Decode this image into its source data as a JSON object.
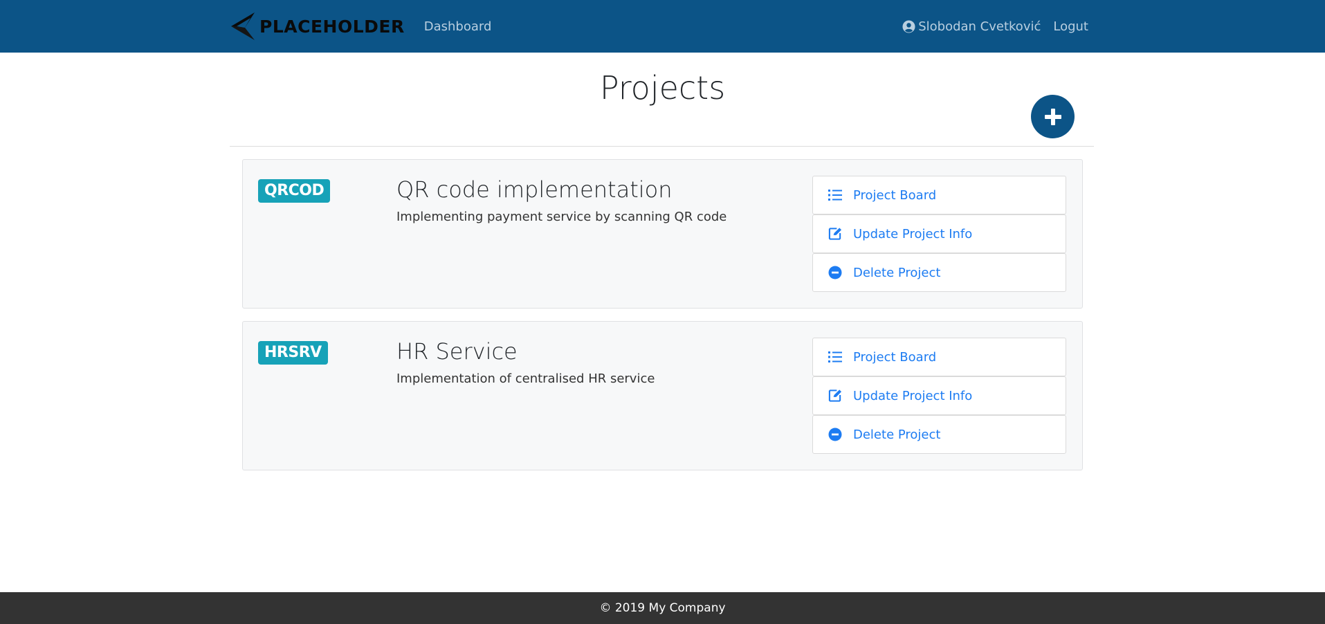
{
  "nav": {
    "brand": "PLACEHOLDER",
    "dashboard": "Dashboard",
    "user_name": "Slobodan Cvetković",
    "logout": "Logut"
  },
  "page": {
    "title": "Projects"
  },
  "projects": [
    {
      "code": "QRCOD",
      "name": "QR code implementation",
      "description": "Implementing payment service by scanning QR code",
      "actions": {
        "board": "Project Board",
        "update": "Update Project Info",
        "delete": "Delete Project"
      }
    },
    {
      "code": "HRSRV",
      "name": "HR Service",
      "description": "Implementation of centralised HR service",
      "actions": {
        "board": "Project Board",
        "update": "Update Project Info",
        "delete": "Delete Project"
      }
    }
  ],
  "footer": {
    "text": "© 2019 My Company"
  },
  "icons": {
    "add": "plus-icon",
    "user": "user-circle-icon",
    "board": "list-icon",
    "update": "edit-icon",
    "delete": "minus-circle-icon"
  },
  "colors": {
    "navbar": "#0c5487",
    "badge": "#17a2b8",
    "link": "#1d7cf2",
    "footer": "#333333"
  }
}
